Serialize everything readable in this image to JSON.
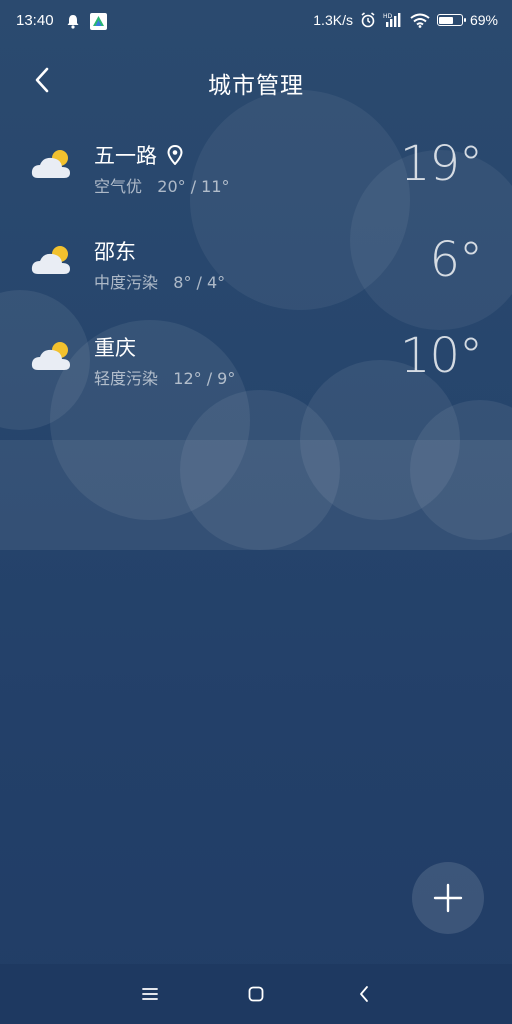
{
  "status_bar": {
    "time": "13:40",
    "net_speed": "1.3K/s",
    "battery_text": "69%",
    "battery_level": 0.69,
    "icons": [
      "bell-icon",
      "app-notification-icon",
      "alarm-icon",
      "hd-signal-icon",
      "wifi-icon",
      "battery-icon"
    ]
  },
  "header": {
    "title": "城市管理",
    "back_icon": "chevron-left-icon"
  },
  "cities": [
    {
      "name": "五一路",
      "located": true,
      "sub": "空气优   20° / 11°",
      "temp": "19°",
      "weather_icon": "partly-cloudy-icon"
    },
    {
      "name": "邵东",
      "located": false,
      "sub": "中度污染   8° / 4°",
      "temp": "6°",
      "weather_icon": "partly-cloudy-icon"
    },
    {
      "name": "重庆",
      "located": false,
      "sub": "轻度污染   12° / 9°",
      "temp": "10°",
      "weather_icon": "partly-cloudy-icon"
    }
  ],
  "fab": {
    "icon": "plus-icon"
  },
  "nav_bar": {
    "icons": [
      "menu-icon",
      "home-icon",
      "back-icon"
    ]
  },
  "colors": {
    "background": "#26456c",
    "sun": "#f2c12e",
    "cloud": "#e9edf4"
  }
}
